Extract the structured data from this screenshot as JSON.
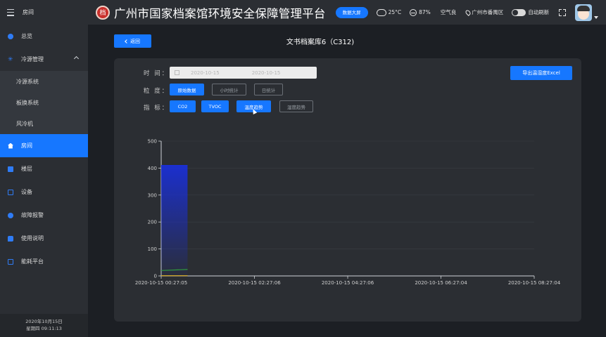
{
  "sidebar": {
    "header_label": "房间",
    "items": [
      {
        "label": "总览"
      },
      {
        "label": "冷源管理"
      },
      {
        "label": "冷源系统"
      },
      {
        "label": "板换系统"
      },
      {
        "label": "风冷机"
      },
      {
        "label": "房间"
      },
      {
        "label": "楼层"
      },
      {
        "label": "设备"
      },
      {
        "label": "故障报警"
      },
      {
        "label": "使用说明"
      },
      {
        "label": "能耗平台"
      }
    ],
    "footer_date": "2020年10月15日",
    "footer_time": "星期四 09:11:13"
  },
  "topbar": {
    "logo_char": "档",
    "title": "广州市国家档案馆环境安全保障管理平台",
    "screen_button": "数据大屏",
    "temperature": "25°C",
    "humidity": "87%",
    "air_quality": "空气良",
    "location": "广州市番禺区",
    "auto_refresh_label": "自动刷新"
  },
  "page": {
    "back_label": "返回",
    "title": "文书档案库6（C312)"
  },
  "filters": {
    "time_label": "时 间：",
    "start_date": "2020-10-15",
    "end_date": "2020-10-15",
    "granularity_label": "粒 度：",
    "granularity": [
      "原始数据",
      "小时统计",
      "日统计"
    ],
    "indicator_label": "指 标：",
    "indicators": [
      "CO2",
      "TVOC",
      "温度趋势",
      "湿度趋势"
    ],
    "export_label": "导出温湿度Excel"
  },
  "colors": {
    "accent": "#1677ff",
    "co2_series": "#1a2fd6",
    "temp_series": "#2e9b3e",
    "humidity_series": "#c9a227"
  },
  "chart_data": {
    "type": "area",
    "x": [
      "2020-10-15 00:27:05",
      "2020-10-15 02:27:06",
      "2020-10-15 04:27:06",
      "2020-10-15 06:27:04",
      "2020-10-15 08:27:04"
    ],
    "ylim": [
      0,
      500
    ],
    "yticks": [
      0,
      100,
      200,
      300,
      400,
      500
    ],
    "grid": true,
    "series": [
      {
        "x_range": [
          "2020-10-15 00:27:05",
          "2020-10-15 01:01:00"
        ],
        "values": [
          410,
          410
        ]
      },
      {
        "x_range": [
          "2020-10-15 00:27:05",
          "2020-10-15 01:01:00"
        ],
        "values": [
          20,
          24
        ]
      },
      {
        "x_range": [
          "2020-10-15 00:27:05",
          "2020-10-15 01:01:00"
        ],
        "values": [
          1,
          1
        ]
      }
    ]
  }
}
